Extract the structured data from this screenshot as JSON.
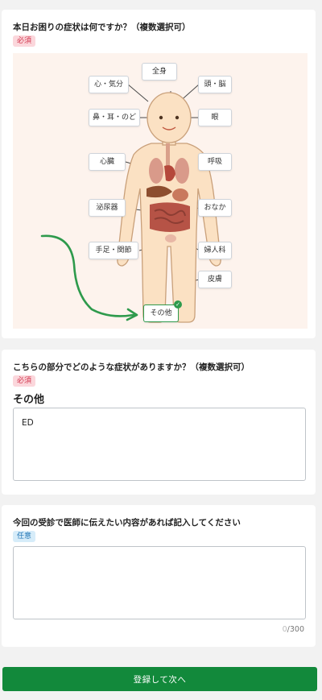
{
  "q1": {
    "title": "本日お困りの症状は何ですか？（複数選択可）",
    "badge": "必須",
    "parts": {
      "zenshin": "全身",
      "shin_kibun": "心・気分",
      "atama_nou": "頭・脳",
      "hana_mimi_nodo": "鼻・耳・のど",
      "me": "眼",
      "shinzou": "心臓",
      "kokyuu": "呼吸",
      "hinyouki": "泌尿器",
      "onaka": "おなか",
      "teashi_kansetsu": "手足・関節",
      "fujinka": "婦人科",
      "hifu": "皮膚",
      "sonota": "その他"
    },
    "selected": "その他",
    "check_icon": "✓",
    "colors": {
      "accent_green": "#2e9a4c",
      "illus_bg": "#fdf3ed"
    }
  },
  "q2": {
    "title": "こちらの部分でどのような症状がありますか？（複数選択可）",
    "badge": "必須",
    "heading": "その他",
    "value": "ED"
  },
  "q3": {
    "title": "今回の受診で医師に伝えたい内容があれば記入してください",
    "badge": "任意",
    "value": "",
    "count_current": "0",
    "count_max": "/300"
  },
  "submit_label": "登録して次へ",
  "colors": {
    "primary": "#12893b",
    "required": "#d2334b",
    "optional": "#2276b5"
  }
}
